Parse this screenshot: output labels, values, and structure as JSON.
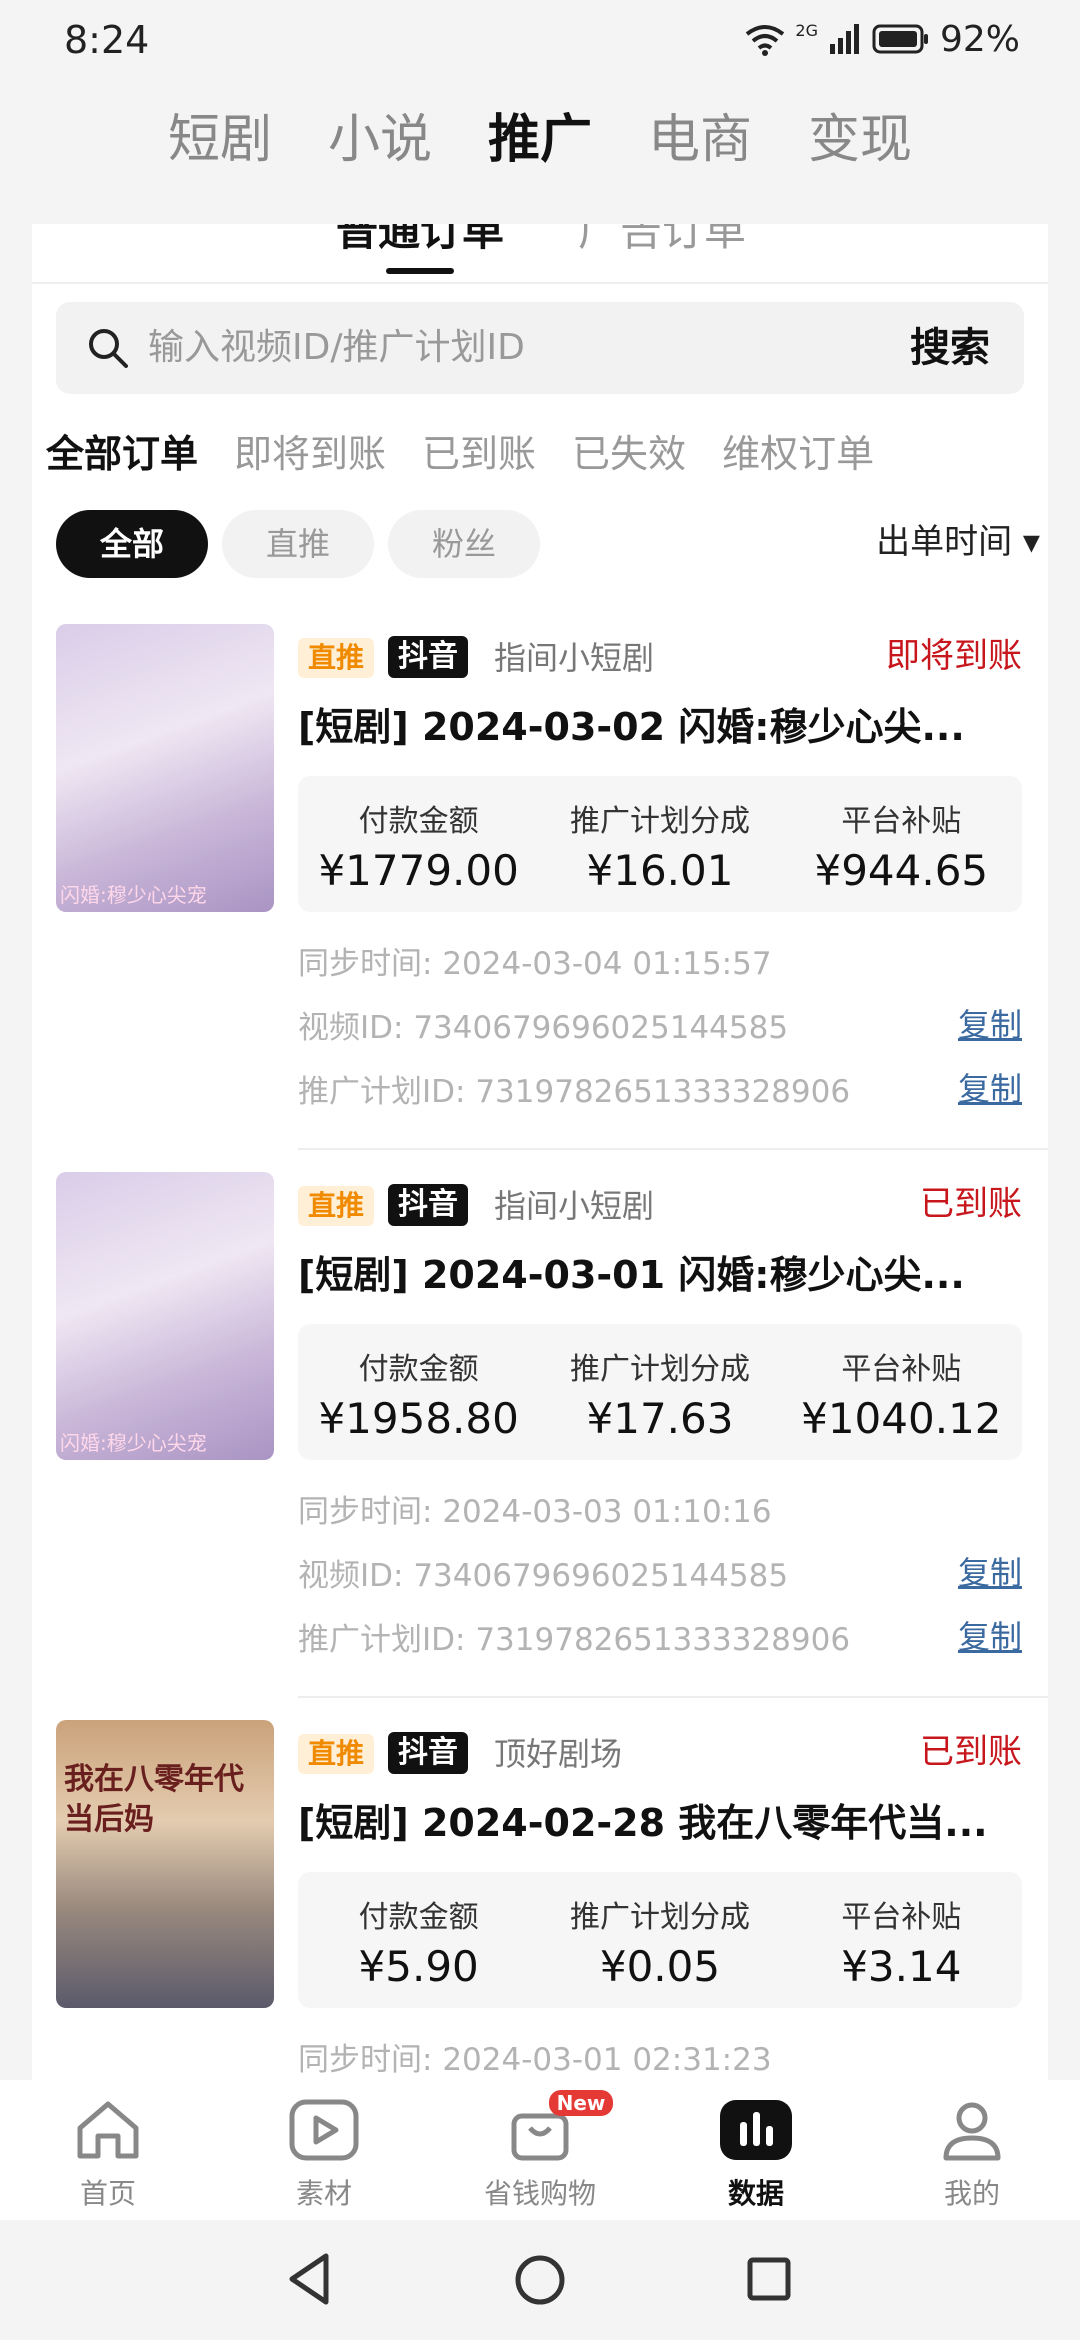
{
  "status_bar": {
    "time": "8:24",
    "battery": "92%",
    "net": "2G"
  },
  "top_tabs": [
    "短剧",
    "小说",
    "推广",
    "电商",
    "变现"
  ],
  "subtabs": [
    "普通订单",
    "广告订单"
  ],
  "search": {
    "placeholder": "输入视频ID/推广计划ID",
    "button": "搜索"
  },
  "filters": [
    "全部订单",
    "即将到账",
    "已到账",
    "已失效",
    "维权订单"
  ],
  "chips": [
    "全部",
    "直推",
    "粉丝"
  ],
  "sort_label": "出单时间 ▾",
  "labels": {
    "tag_direct": "直推",
    "tag_douyin": "抖音",
    "pay": "付款金额",
    "share": "推广计划分成",
    "subsidy": "平台补贴",
    "sync_prefix": "同步时间:",
    "video_prefix": "视频ID:",
    "plan_prefix": "推广计划ID:",
    "copy": "复制"
  },
  "orders": [
    {
      "channel": "指间小短剧",
      "status": "即将到账",
      "title": "[短剧] 2024-03-02 闪婚:穆少心尖...",
      "pay": "¥1779.00",
      "share": "¥16.01",
      "subsidy": "¥944.65",
      "sync_time": "2024-03-04 01:15:57",
      "video_id": "7340679696025144585",
      "plan_id": "7319782651333328906",
      "thumb_caption": "闪婚:穆少心尖宠"
    },
    {
      "channel": "指间小短剧",
      "status": "已到账",
      "title": "[短剧] 2024-03-01 闪婚:穆少心尖...",
      "pay": "¥1958.80",
      "share": "¥17.63",
      "subsidy": "¥1040.12",
      "sync_time": "2024-03-03 01:10:16",
      "video_id": "7340679696025144585",
      "plan_id": "7319782651333328906",
      "thumb_caption": "闪婚:穆少心尖宠"
    },
    {
      "channel": "顶好剧场",
      "status": "已到账",
      "title": "[短剧] 2024-02-28 我在八零年代当...",
      "pay": "¥5.90",
      "share": "¥0.05",
      "subsidy": "¥3.14",
      "sync_time": "2024-03-01 02:31:23",
      "thumb_caption": "我在八零年代当后妈"
    }
  ],
  "bottom_nav": [
    "首页",
    "素材",
    "省钱购物",
    "数据",
    "我的"
  ],
  "new_badge": "New"
}
